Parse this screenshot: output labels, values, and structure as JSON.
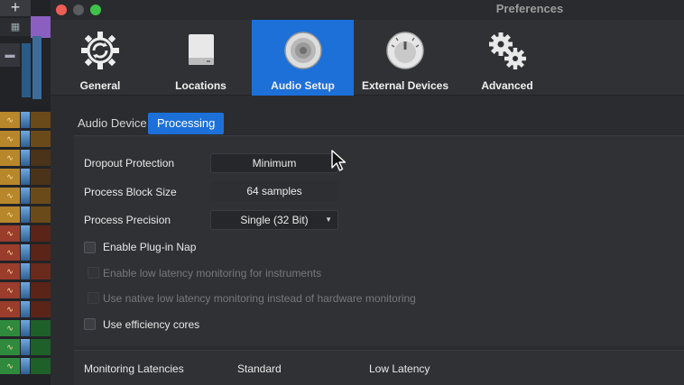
{
  "window": {
    "title": "Preferences"
  },
  "toolbar": {
    "items": [
      {
        "label": "General",
        "icon": "gear-refresh-icon"
      },
      {
        "label": "Locations",
        "icon": "drive-icon"
      },
      {
        "label": "Audio Setup",
        "icon": "speaker-icon",
        "selected": true
      },
      {
        "label": "External Devices",
        "icon": "knob-icon"
      },
      {
        "label": "Advanced",
        "icon": "gears-icon"
      }
    ]
  },
  "tabs": [
    {
      "label": "Audio Device"
    },
    {
      "label": "Processing",
      "active": true
    }
  ],
  "processing": {
    "dropout_protection": {
      "label": "Dropout Protection",
      "value": "Minimum"
    },
    "process_block_size": {
      "label": "Process Block Size",
      "value": "64 samples"
    },
    "process_precision": {
      "label": "Process Precision",
      "value": "Single (32 Bit)"
    },
    "plugin_nap": {
      "label": "Enable Plug-in Nap",
      "checked": false
    },
    "low_latency_instruments": {
      "label": "Enable low latency monitoring for instruments",
      "enabled": false
    },
    "native_low_latency": {
      "label": "Use native low latency monitoring instead of hardware monitoring",
      "enabled": false
    },
    "efficiency_cores": {
      "label": "Use efficiency cores",
      "checked": false
    }
  },
  "latencies": {
    "heading": "Monitoring Latencies",
    "col_standard": "Standard",
    "col_low": "Low Latency"
  },
  "daw": {
    "add_button": "+"
  },
  "colors": {
    "accent": "#1c70d8",
    "traffic_red": "#ed5f56",
    "traffic_gray": "#5a5b5f",
    "traffic_green": "#3fc14a"
  }
}
